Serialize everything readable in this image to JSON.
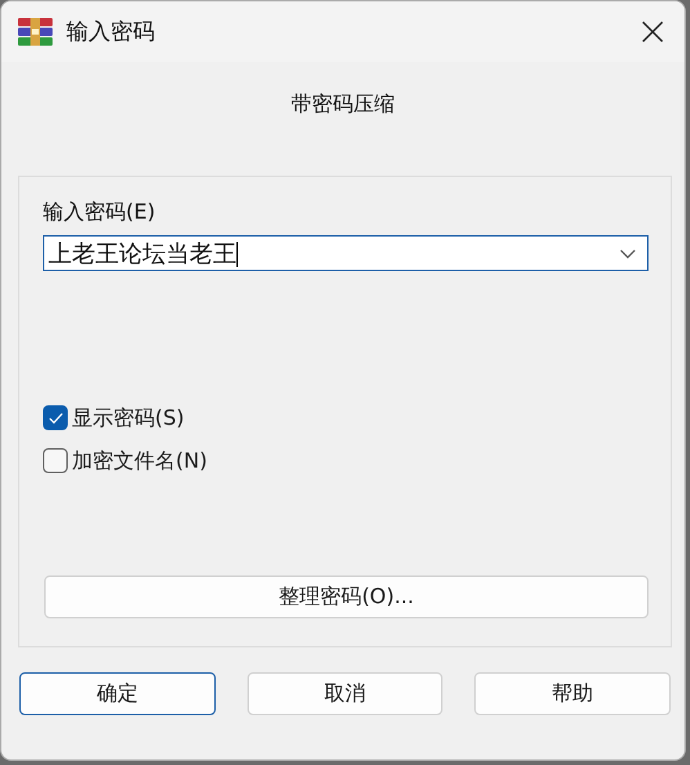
{
  "window": {
    "title": "输入密码"
  },
  "heading": "带密码压缩",
  "password": {
    "label": "输入密码(E)",
    "value": "上老王论坛当老王"
  },
  "options": [
    {
      "label": "显示密码(S)",
      "checked": true
    },
    {
      "label": "加密文件名(N)",
      "checked": false
    }
  ],
  "organize_button": "整理密码(O)...",
  "buttons": [
    {
      "label": "确定",
      "default": true
    },
    {
      "label": "取消",
      "default": false
    },
    {
      "label": "帮助",
      "default": false
    }
  ]
}
